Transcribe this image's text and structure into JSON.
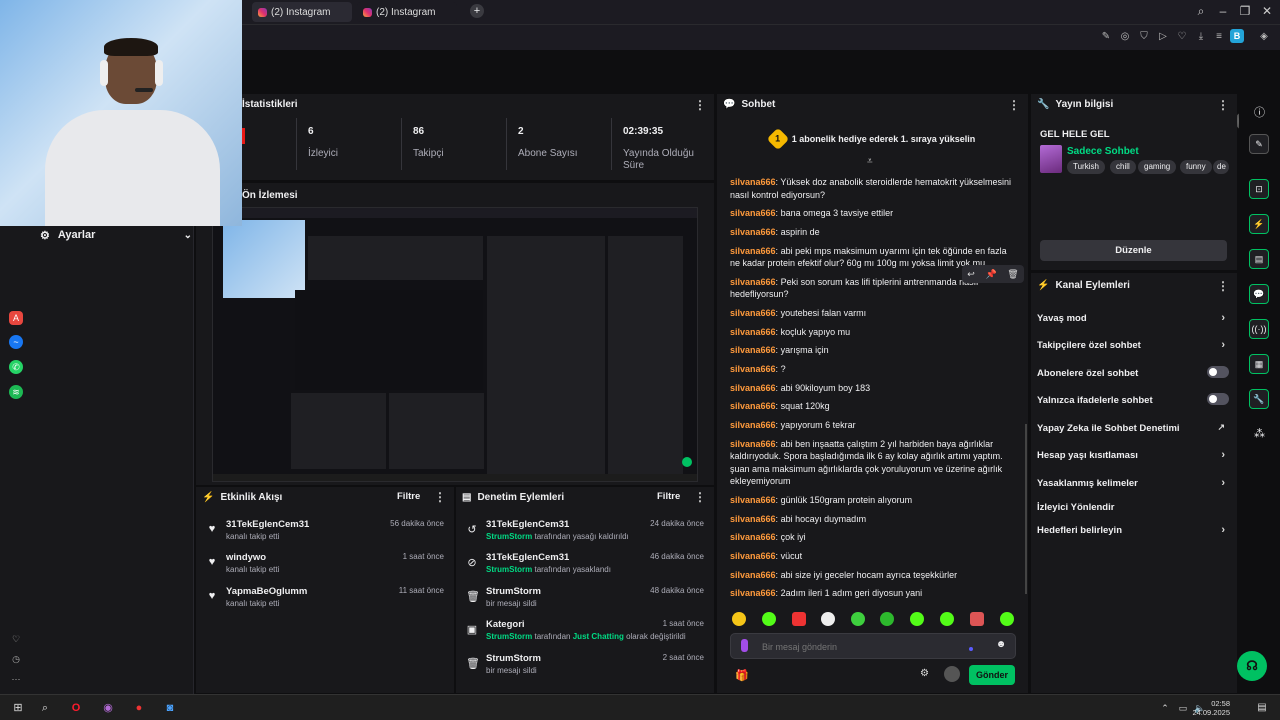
{
  "browser": {
    "tabs": [
      {
        "label": "(2) Instagram"
      },
      {
        "label": "(2) Instagram"
      }
    ],
    "new_tab": "+"
  },
  "stats": {
    "title": "İstatistikleri",
    "items": [
      {
        "value": "6",
        "label": "İzleyici"
      },
      {
        "value": "86",
        "label": "Takipçi"
      },
      {
        "value": "2",
        "label": "Abone Sayısı"
      },
      {
        "value": "02:39:35",
        "label": "Yayında Olduğu Süre"
      }
    ]
  },
  "settings": {
    "title": "Ayarlar"
  },
  "preview": {
    "title": "Ön İzlemesi"
  },
  "activity": {
    "title": "Etkinlik Akışı",
    "filter": "Filtre",
    "items": [
      {
        "user": "31TekEglenCem31",
        "sub": "kanalı takip etti",
        "time": "56 dakika önce"
      },
      {
        "user": "windywo",
        "sub": "kanalı takip etti",
        "time": "1 saat önce"
      },
      {
        "user": "YapmaBeOglumm",
        "sub": "kanalı takip etti",
        "time": "11 saat önce"
      }
    ]
  },
  "modlog": {
    "title": "Denetim Eylemleri",
    "filter": "Filtre",
    "items": [
      {
        "user": "31TekEglenCem31",
        "actor": "StrumStorm",
        "sub": "tarafından yasağı kaldırıldı",
        "time": "24 dakika önce",
        "icon": "undo-icon"
      },
      {
        "user": "31TekEglenCem31",
        "actor": "StrumStorm",
        "sub": "tarafından yasaklandı",
        "time": "46 dakika önce",
        "icon": "ban-icon"
      },
      {
        "user": "StrumStorm",
        "actor": "",
        "sub": "bir mesajı sildi",
        "time": "48 dakika önce",
        "icon": "trash-icon"
      },
      {
        "user": "Kategori",
        "actor": "StrumStorm",
        "sub": "tarafından",
        "extra": "Just Chatting",
        "sub2": "olarak değiştirildi",
        "time": "1 saat önce",
        "icon": "category-icon"
      },
      {
        "user": "StrumStorm",
        "actor": "",
        "sub": "bir mesajı sildi",
        "time": "2 saat önce",
        "icon": "trash-icon"
      }
    ]
  },
  "chat": {
    "title": "Sohbet",
    "promo_rank": "1",
    "promo": "1 abonelik hediye ederek 1. sıraya yükselin",
    "messages": [
      {
        "name": "silvana666",
        "text": "Yüksek doz anabolik steroidlerde hematokrit yükselmesini nasıl kontrol ediyorsun?"
      },
      {
        "name": "silvana666",
        "text": "bana omega 3 tavsiye ettiler"
      },
      {
        "name": "silvana666",
        "text": "aspirin de"
      },
      {
        "name": "silvana666",
        "text": "abi peki mps maksimum uyarımı için tek öğünde en fazla ne kadar protein efektif olur? 60g mı 100g mı yoksa limit yok mu"
      },
      {
        "name": "silvana666",
        "text": "Peki son sorum kas lifi tiplerini antrenmanda nasıl hedefliyorsun?"
      },
      {
        "name": "silvana666",
        "text": "youtebesi falan varmı"
      },
      {
        "name": "silvana666",
        "text": "koçluk yapıyo mu"
      },
      {
        "name": "silvana666",
        "text": "yarışma için"
      },
      {
        "name": "silvana666",
        "text": "?"
      },
      {
        "name": "silvana666",
        "text": "abi 90kiloyum boy 183"
      },
      {
        "name": "silvana666",
        "text": "squat 120kg"
      },
      {
        "name": "silvana666",
        "text": "yapıyorum 6 tekrar"
      },
      {
        "name": "silvana666",
        "text": "abi ben inşaatta çalıştım 2 yıl harbiden baya ağırlıklar kaldırıyoduk. Spora başladığımda ilk 6 ay kolay ağırlık artımı yaptım. şuan ama maksimum ağırlıklarda çok yoruluyorum ve üzerine ağırlık ekleyemiyorum"
      },
      {
        "name": "silvana666",
        "text": "günlük 150gram protein alıyorum"
      },
      {
        "name": "silvana666",
        "text": "abi hocayı duymadım"
      },
      {
        "name": "silvana666",
        "text": "çok iyi"
      },
      {
        "name": "silvana666",
        "text": "vücut"
      },
      {
        "name": "silvana666",
        "text": "abi size iyi geceler hocam ayrıca teşekkürler"
      },
      {
        "name": "silvana666",
        "text": "2adım ileri 1 adım geri diyosun yani"
      }
    ],
    "input_placeholder": "Bir mesaj gönderin",
    "send": "Gönder"
  },
  "stream_info": {
    "title": "Yayın bilgisi",
    "stream_title": "GEL HELE GEL",
    "category": "Sadece Sohbet",
    "tags": [
      "Turkish",
      "chill",
      "gaming",
      "funny",
      "de"
    ],
    "edit": "Düzenle"
  },
  "channel_actions": {
    "title": "Kanal Eylemleri",
    "items": [
      {
        "label": "Yavaş mod",
        "kind": "chevron"
      },
      {
        "label": "Takipçilere özel sohbet",
        "kind": "chevron"
      },
      {
        "label": "Abonelere özel sohbet",
        "kind": "toggle"
      },
      {
        "label": "Yalnızca ifadelerle sohbet",
        "kind": "toggle"
      },
      {
        "label": "Yapay Zeka ile Sohbet Denetimi",
        "kind": "external"
      },
      {
        "label": "Hesap yaşı kısıtlaması",
        "kind": "chevron"
      },
      {
        "label": "Yasaklanmış kelimeler",
        "kind": "chevron"
      },
      {
        "label": "İzleyici Yönlendir",
        "kind": "none"
      },
      {
        "label": "Hedefleri belirleyin",
        "kind": "chevron"
      }
    ]
  },
  "taskbar": {
    "time": "02:58",
    "date": "24.09.2025"
  },
  "colors": {
    "accent": "#00c162",
    "chat_name": "#ff9a3c",
    "panel": "#18181b",
    "bg": "#0e0e10"
  }
}
